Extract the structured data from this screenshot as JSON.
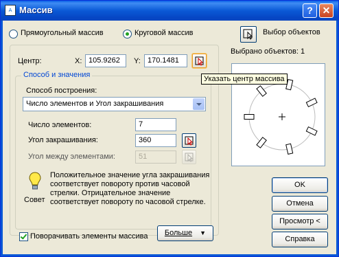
{
  "window": {
    "title": "Массив"
  },
  "array_type": {
    "rectangular_label": "Прямоугольный массив",
    "polar_label": "Круговой массив",
    "selected": "polar"
  },
  "select_objects": {
    "button_label": "Выбор объектов",
    "count_text": "Выбрано объектов: 1"
  },
  "center": {
    "label": "Центр:",
    "x_label": "X:",
    "x_value": "105.9262",
    "y_label": "Y:",
    "y_value": "170.1481"
  },
  "tooltip": "Указать центр массива",
  "method_group": {
    "title": "Способ и значения",
    "method_label": "Способ построения:",
    "method_value": "Число элементов и Угол закрашивания",
    "total_items_label": "Число элементов:",
    "total_items_value": "7",
    "angle_fill_label": "Угол закрашивания:",
    "angle_fill_value": "360",
    "angle_between_label": "Угол между элементами:",
    "angle_between_value": "51"
  },
  "tip": {
    "label": "Совет",
    "text_lines": [
      "Положительное значение угла закрашивания",
      "соответствует повороту против часовой",
      "стрелки. Отрицательное значение",
      "соответствует повороту по часовой стрелке."
    ]
  },
  "rotate_items": {
    "label": "Поворачивать элементы массива",
    "checked": true
  },
  "more_button": {
    "label": "Больше"
  },
  "buttons": {
    "ok": "OK",
    "cancel": "Отмена",
    "preview": "Просмотр <",
    "help": "Справка"
  },
  "preview_rect_count": 7
}
